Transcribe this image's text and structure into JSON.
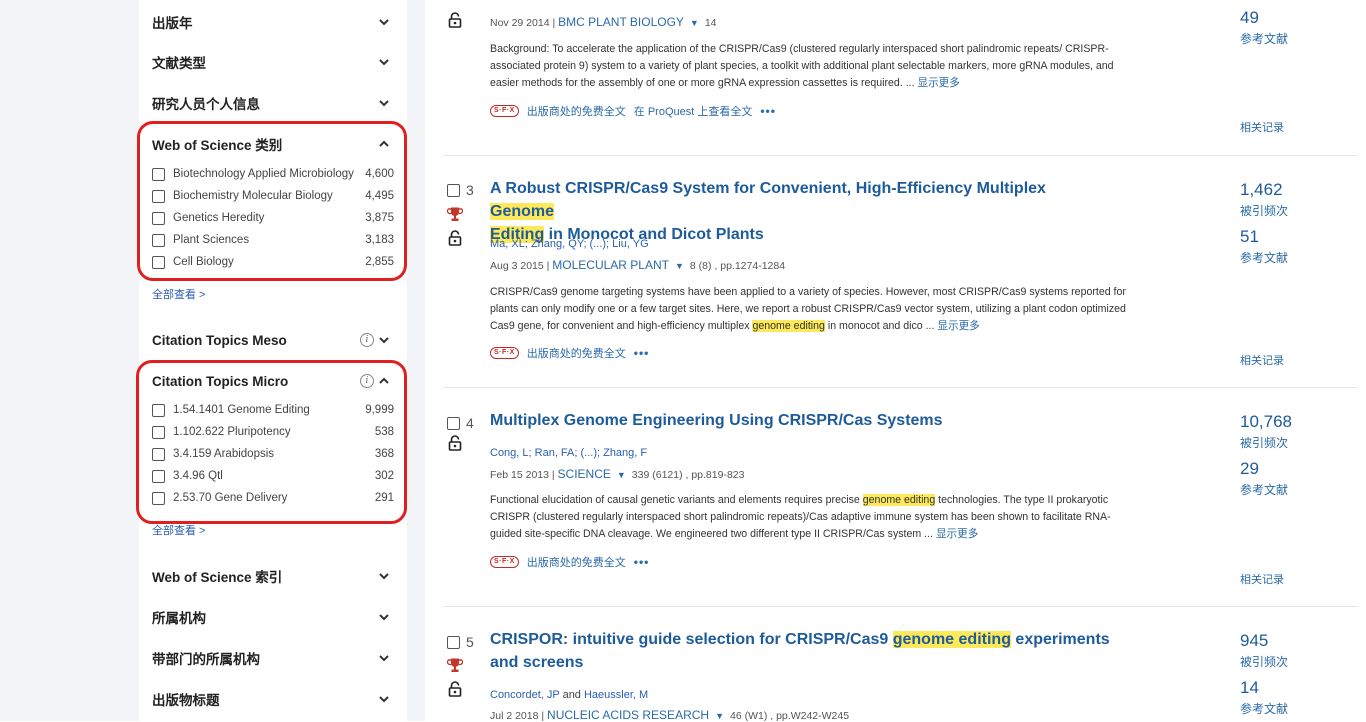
{
  "sidebar": {
    "sections": [
      {
        "label": "出版年"
      },
      {
        "label": "文献类型"
      },
      {
        "label": "研究人员个人信息"
      },
      {
        "label": "Web of Science 类别"
      },
      {
        "label": "Citation Topics Meso"
      },
      {
        "label": "Citation Topics Micro"
      },
      {
        "label": "Web of Science 索引"
      },
      {
        "label": "所属机构"
      },
      {
        "label": "带部门的所属机构"
      },
      {
        "label": "出版物标题"
      }
    ],
    "wos_categories": [
      {
        "name": "Biotechnology Applied Microbiology",
        "count": "4,600"
      },
      {
        "name": "Biochemistry Molecular Biology",
        "count": "4,495"
      },
      {
        "name": "Genetics Heredity",
        "count": "3,875"
      },
      {
        "name": "Plant Sciences",
        "count": "3,183"
      },
      {
        "name": "Cell Biology",
        "count": "2,855"
      }
    ],
    "micro_topics": [
      {
        "name": "1.54.1401 Genome Editing",
        "count": "9,999"
      },
      {
        "name": "1.102.622 Pluripotency",
        "count": "538"
      },
      {
        "name": "3.4.159 Arabidopsis",
        "count": "368"
      },
      {
        "name": "3.4.96 Qtl",
        "count": "302"
      },
      {
        "name": "2.53.70 Gene Delivery",
        "count": "291"
      }
    ],
    "see_all": "全部查看 >",
    "info_glyph": "i"
  },
  "records": [
    {
      "pub_date": "Nov 29 2014 | ",
      "journal": "BMC PLANT BIOLOGY",
      "issue": "14",
      "abstract": "Background: To accelerate the application of the CRISPR/Cas9 (clustered regularly interspaced short palindromic repeats/ CRISPR-associated protein 9) system to a variety of plant species, a toolkit with additional plant selectable markers, more gRNA modules, and easier methods for the assembly of one or more gRNA expression cassettes is required.",
      "ellipsis": "  ...",
      "show_more": "显示更多",
      "link_free": "出版商处的免费全文",
      "link_proquest": "在 ProQuest 上查看全文",
      "refs_count": "49",
      "refs_label": "参考文献",
      "related": "相关记录"
    },
    {
      "index": "3",
      "title_pre": "A Robust CRISPR/Cas9 System for Convenient, High-Efficiency Multiplex ",
      "title_hl1": "Genome",
      "title_hl2": "Editing",
      "title_post": " in Monocot and Dicot Plants",
      "authors": "Ma, XL; Zhang, QY; (...); Liu, YG",
      "pub_date": "Aug 3 2015 | ",
      "journal": "MOLECULAR PLANT",
      "issue": "8 (8) , pp.1274-1284",
      "abstract_pre": "CRISPR/Cas9 genome targeting systems have been applied to a variety of species. However, most CRISPR/Cas9 systems reported for plants can only modify one or a few target sites. Here, we report a robust CRISPR/Cas9 vector system, utilizing a plant codon optimized Cas9 gene, for convenient and high-efficiency multiplex ",
      "abstract_hl": "genome editing",
      "abstract_post": " in monocot and dico",
      "ellipsis": "  ...",
      "show_more": "显示更多",
      "link_free": "出版商处的免费全文",
      "cited_count": "1,462",
      "cited_label": "被引频次",
      "refs_count": "51",
      "refs_label": "参考文献",
      "related": "相关记录"
    },
    {
      "index": "4",
      "title": "Multiplex Genome Engineering Using CRISPR/Cas Systems",
      "authors": "Cong, L; Ran, FA; (...); Zhang, F",
      "pub_date": "Feb 15 2013 | ",
      "journal": "SCIENCE",
      "issue": "339 (6121) , pp.819-823",
      "abstract_pre": "Functional elucidation of causal genetic variants and elements requires precise ",
      "abstract_hl": "genome editing",
      "abstract_post": " technologies. The type II prokaryotic CRISPR (clustered regularly interspaced short palindromic repeats)/Cas adaptive immune system has been shown to facilitate RNA-guided site-specific DNA cleavage. We engineered two different type II CRISPR/Cas system",
      "ellipsis": "  ...",
      "show_more": "显示更多",
      "link_free": "出版商处的免费全文",
      "cited_count": "10,768",
      "cited_label": "被引频次",
      "refs_count": "29",
      "refs_label": "参考文献",
      "related": "相关记录"
    },
    {
      "index": "5",
      "title_pre": "CRISPOR: intuitive guide selection for CRISPR/Cas9 ",
      "title_hl": "genome editing",
      "title_post": " experiments and screens",
      "author1": "Concordet, JP",
      "and": " and ",
      "author2": "Haeussler, M",
      "pub_date": "Jul 2 2018 | ",
      "journal": "NUCLEIC ACIDS RESEARCH",
      "issue": "46 (W1) , pp.W242-W245",
      "cited_count": "945",
      "cited_label": "被引频次",
      "refs_count": "14",
      "refs_label": "参考文献"
    }
  ],
  "sfx_badge": "S·F·X",
  "more_dots": "•••",
  "colors": {
    "accent": "#1e5b9b",
    "highlight": "#fde95a",
    "annotation_red": "#e02020",
    "trophy": "#c0392b"
  }
}
